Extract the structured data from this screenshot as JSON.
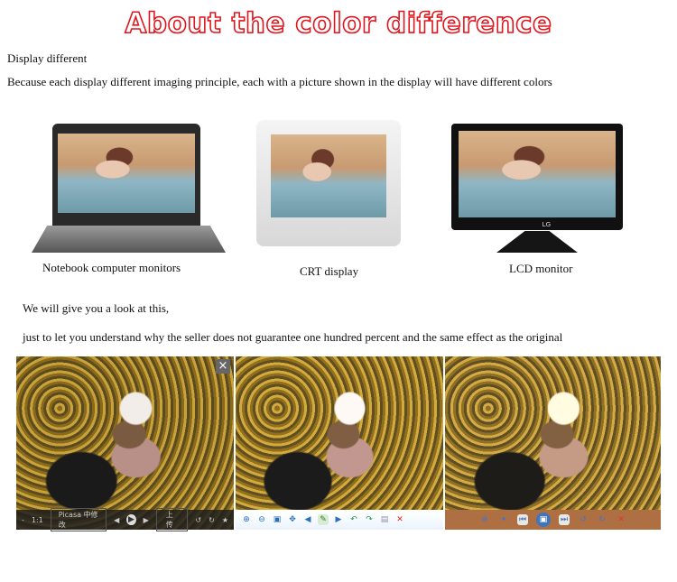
{
  "title": "About the color difference",
  "intro": {
    "heading": "Display different",
    "body": "Because each display different imaging principle, each with a picture shown in the display will have different colors"
  },
  "monitors": [
    {
      "label": "Notebook computer monitors"
    },
    {
      "label": "CRT display"
    },
    {
      "label": "LCD monitor",
      "brand": "LG"
    }
  ],
  "comparison": {
    "line1": "We will give you a look at this,",
    "line2": "just to let you understand why the seller does not guarantee one hundred percent and the same effect as the original"
  },
  "viewers": [
    {
      "toolbar": [
        "-",
        "1:1",
        "Picasa 中修改",
        "◀",
        "▶",
        "▶",
        "上传",
        "↺",
        "↻",
        "★"
      ],
      "close": "×"
    },
    {
      "toolbar": [
        "⊕",
        "⊖",
        "▣",
        "✥",
        "◀",
        "✎",
        "▶",
        "↶",
        "↷",
        "▤",
        "✕"
      ]
    },
    {
      "toolbar": [
        "⊕",
        "✦",
        "⏮",
        "▣",
        "⏭",
        "↺",
        "↻",
        "✕"
      ]
    }
  ]
}
